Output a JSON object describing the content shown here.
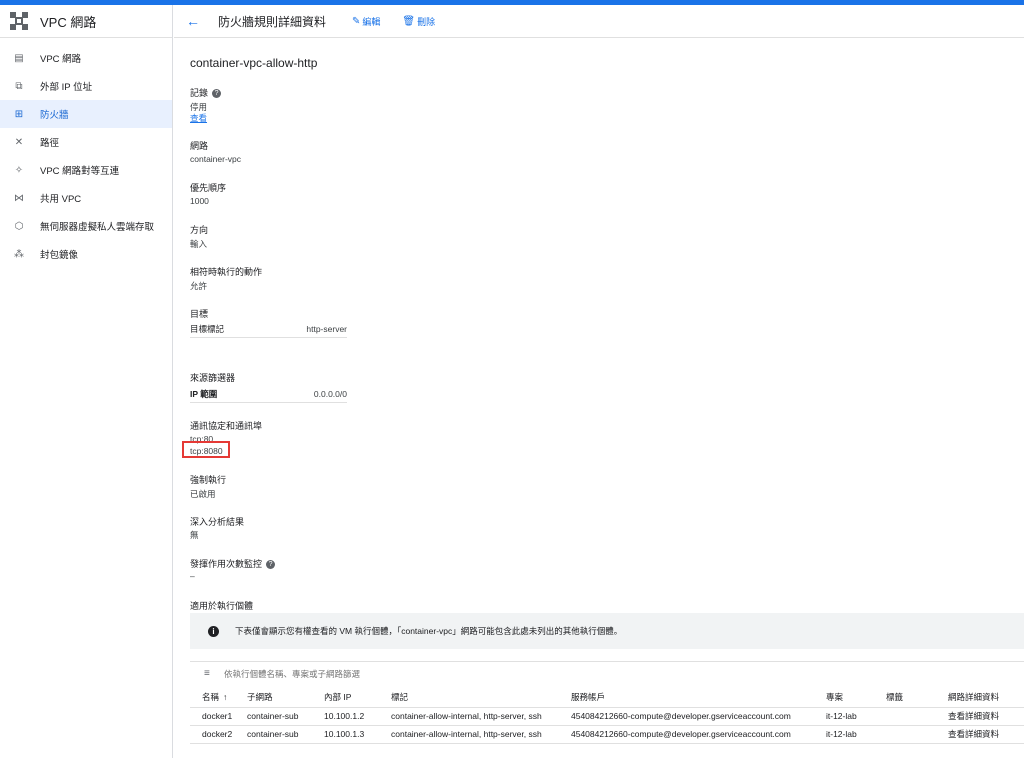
{
  "colors": {
    "accent": "#1a73e8",
    "highlight_border": "#e53935",
    "active_bg": "#e8f0fe"
  },
  "sidebar": {
    "title": "VPC 網路",
    "items": [
      {
        "label": "VPC 網路",
        "icon": "vpc-network-icon"
      },
      {
        "label": "外部 IP 位址",
        "icon": "external-ip-icon"
      },
      {
        "label": "防火牆",
        "icon": "firewall-icon",
        "active": true
      },
      {
        "label": "路徑",
        "icon": "routes-icon"
      },
      {
        "label": "VPC 網路對等互連",
        "icon": "peering-icon"
      },
      {
        "label": "共用 VPC",
        "icon": "shared-vpc-icon"
      },
      {
        "label": "無伺服器虛擬私人雲端存取",
        "icon": "serverless-access-icon"
      },
      {
        "label": "封包鏡像",
        "icon": "packet-mirroring-icon"
      }
    ]
  },
  "header": {
    "title": "防火牆規則詳細資料",
    "edit_label": "編輯",
    "delete_label": "刪除"
  },
  "rule": {
    "name": "container-vpc-allow-http",
    "logs_label": "記錄",
    "logs_value": "停用",
    "logs_link": "查看",
    "network_label": "網路",
    "network_value": "container-vpc",
    "priority_label": "優先順序",
    "priority_value": "1000",
    "direction_label": "方向",
    "direction_value": "輸入",
    "action_label": "相符時執行的動作",
    "action_value": "允許",
    "targets_label": "目標",
    "targets_key": "目標標記",
    "targets_value": "http-server",
    "source_label": "來源篩選器",
    "source_key": "IP 範圍",
    "source_value": "0.0.0.0/0",
    "protocols_label": "通訊協定和通訊埠",
    "protocols": [
      "tcp:80",
      "tcp:8080"
    ],
    "enforcement_label": "強制執行",
    "enforcement_value": "已啟用",
    "insights_label": "深入分析結果",
    "insights_value": "無",
    "hit_count_label": "發揮作用次數監控",
    "hit_count_value": "–",
    "applicable_label": "適用於執行個體"
  },
  "banner": {
    "text": "下表僅會顯示您有權查看的 VM 執行個體，「container-vpc」網路可能包含此處未列出的其他執行個體。"
  },
  "filter": {
    "placeholder": "依執行個體名稱、專案或子網路篩選"
  },
  "instances": {
    "columns": [
      "名稱",
      "子網路",
      "內部 IP",
      "標記",
      "服務帳戶",
      "專案",
      "標籤",
      "網路詳細資料"
    ],
    "rows": [
      {
        "name": "docker1",
        "subnet": "container-sub",
        "ip": "10.100.1.2",
        "tags": "container-allow-internal, http-server, ssh",
        "account": "454084212660-compute@developer.gserviceaccount.com",
        "project": "it-12-lab",
        "labels": "",
        "details": "查看詳細資料"
      },
      {
        "name": "docker2",
        "subnet": "container-sub",
        "ip": "10.100.1.3",
        "tags": "container-allow-internal, http-server, ssh",
        "account": "454084212660-compute@developer.gserviceaccount.com",
        "project": "it-12-lab",
        "labels": "",
        "details": "查看詳細資料"
      }
    ]
  }
}
